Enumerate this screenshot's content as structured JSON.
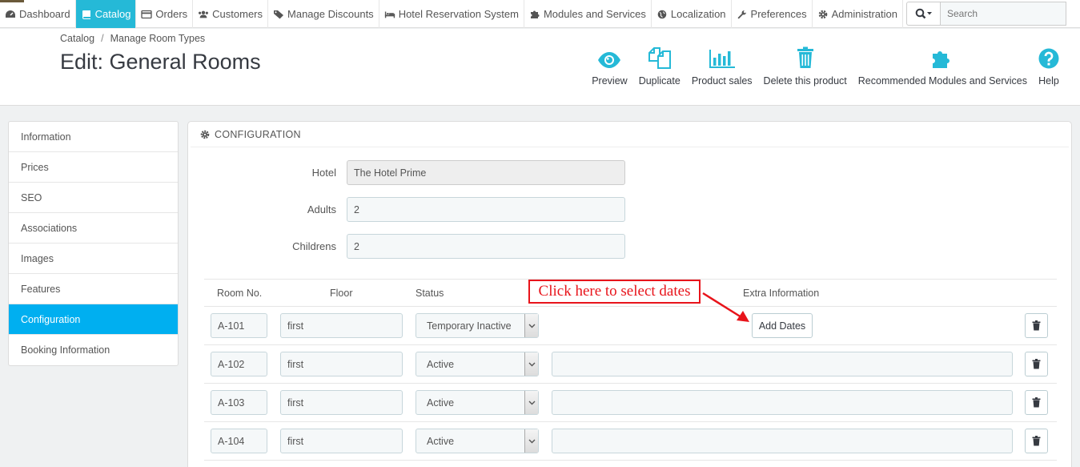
{
  "nav": {
    "items": [
      {
        "label": "Dashboard",
        "icon": "dashboard-icon"
      },
      {
        "label": "Catalog",
        "icon": "book-icon",
        "active": true
      },
      {
        "label": "Orders",
        "icon": "credit-card-icon"
      },
      {
        "label": "Customers",
        "icon": "users-icon"
      },
      {
        "label": "Manage Discounts",
        "icon": "tag-icon"
      },
      {
        "label": "Hotel Reservation System",
        "icon": "bed-icon"
      },
      {
        "label": "Modules and Services",
        "icon": "puzzle-icon"
      },
      {
        "label": "Localization",
        "icon": "globe-icon"
      },
      {
        "label": "Preferences",
        "icon": "wrench-icon"
      },
      {
        "label": "Administration",
        "icon": "cog-icon"
      }
    ],
    "search_placeholder": "Search"
  },
  "header": {
    "breadcrumb": [
      "Catalog",
      "Manage Room Types"
    ],
    "breadcrumb_sep": "/",
    "title": "Edit: General Rooms",
    "toolbar": [
      {
        "label": "Preview",
        "icon": "eye-icon"
      },
      {
        "label": "Duplicate",
        "icon": "copy-icon"
      },
      {
        "label": "Product sales",
        "icon": "bar-chart-icon"
      },
      {
        "label": "Delete this product",
        "icon": "trash-icon"
      },
      {
        "label": "Recommended Modules and Services",
        "icon": "puzzle-icon"
      },
      {
        "label": "Help",
        "icon": "question-icon"
      }
    ]
  },
  "tabs": [
    {
      "label": "Information"
    },
    {
      "label": "Prices"
    },
    {
      "label": "SEO"
    },
    {
      "label": "Associations"
    },
    {
      "label": "Images"
    },
    {
      "label": "Features"
    },
    {
      "label": "Configuration",
      "active": true
    },
    {
      "label": "Booking Information"
    }
  ],
  "panel": {
    "heading": "CONFIGURATION",
    "fields": {
      "hotel": {
        "label": "Hotel",
        "value": "The Hotel Prime"
      },
      "adults": {
        "label": "Adults",
        "value": "2"
      },
      "childrens": {
        "label": "Childrens",
        "value": "2"
      }
    },
    "table": {
      "headers": {
        "room_no": "Room No.",
        "floor": "Floor",
        "status": "Status",
        "extra": "Extra Information"
      },
      "rows": [
        {
          "room_no": "A-101",
          "floor": "first",
          "status": "Temporary Inactive",
          "add_dates_label": "Add Dates"
        },
        {
          "room_no": "A-102",
          "floor": "first",
          "status": "Active"
        },
        {
          "room_no": "A-103",
          "floor": "first",
          "status": "Active"
        },
        {
          "room_no": "A-104",
          "floor": "first",
          "status": "Active"
        }
      ]
    }
  },
  "annotation": {
    "text": "Click here to select dates",
    "color": "#e8141b"
  },
  "colors": {
    "accent": "#25b9d7",
    "tab_active": "#00aff0",
    "icon_blue": "#25b9d7"
  }
}
